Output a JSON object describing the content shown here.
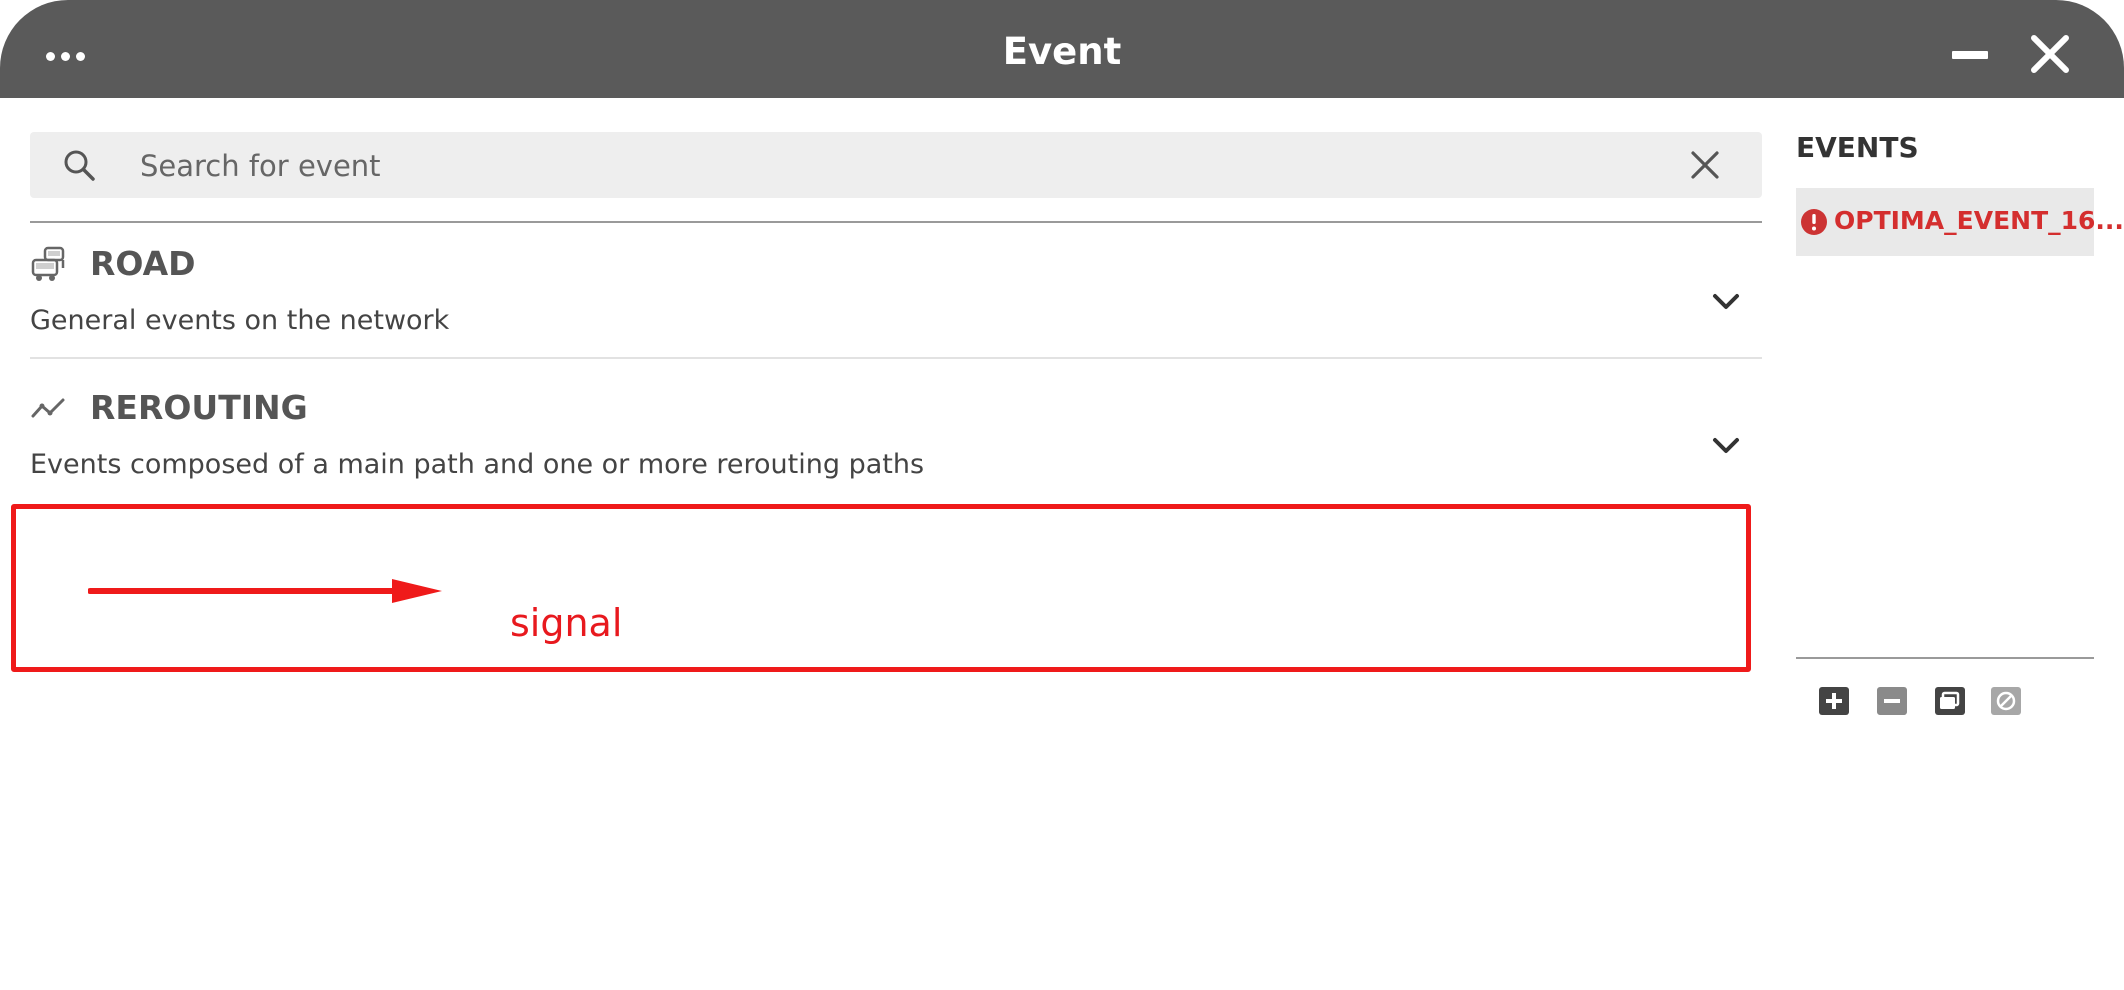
{
  "window": {
    "title": "Event",
    "icons": {
      "menu": "more-dots-icon",
      "minimize": "minimize-icon",
      "close": "close-icon"
    }
  },
  "search": {
    "placeholder": "Search for event",
    "value": "",
    "icons": {
      "search": "search-icon",
      "clear": "clear-icon"
    }
  },
  "categories": [
    {
      "title": "ROAD",
      "description": "General events on the network",
      "icon": "traffic-cars-icon",
      "expander": "chevron-down-icon"
    },
    {
      "title": "REROUTING",
      "description": "Events composed of a main path and one or more rerouting paths",
      "icon": "route-line-icon",
      "expander": "chevron-down-icon"
    }
  ],
  "annotation": {
    "text": "signal",
    "color": "#e8191e"
  },
  "events_panel": {
    "header": "EVENTS",
    "items": [
      {
        "label": "OPTIMA_EVENT_16...",
        "status_icon": "alert-circle-icon",
        "color": "#d42e2e"
      }
    ],
    "toolbar": [
      "add-icon",
      "remove-icon",
      "copy-icon",
      "disable-icon"
    ]
  },
  "colors": {
    "titlebar": "#5a5a5a",
    "search_background": "#eeeeee",
    "selected_item_background": "#e9e9e9"
  }
}
